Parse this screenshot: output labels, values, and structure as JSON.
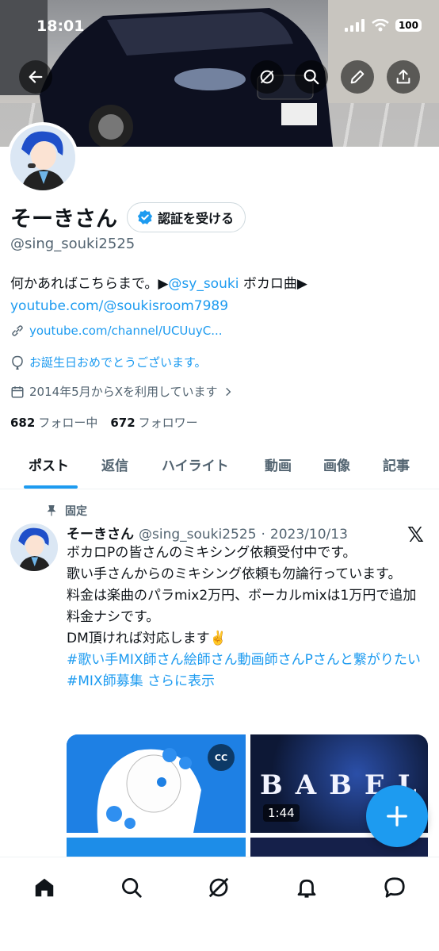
{
  "status": {
    "time": "18:01",
    "battery": "100"
  },
  "profile": {
    "display_name": "そーきさん",
    "verify_button": "認証を受ける",
    "handle": "@sing_souki2525",
    "bio_text": "何かあればこちらまで。▶",
    "bio_mention": "@sy_souki",
    "bio_text2": " ボカロ曲▶",
    "bio_link": "youtube.com/@soukisroom7989",
    "website": "youtube.com/channel/UCUuyC...",
    "birthday": "お誕生日おめでとうございます。",
    "joined": "2014年5月からXを利用しています",
    "following_count": "682",
    "following_label": "フォロー中",
    "followers_count": "672",
    "followers_label": "フォロワー"
  },
  "tabs": [
    "ポスト",
    "返信",
    "ハイライト",
    "動画",
    "画像",
    "記事"
  ],
  "post": {
    "pinned_label": "固定",
    "author_name": "そーきさん",
    "author_handle": "@sing_souki2525",
    "separator": "·",
    "date": "2023/10/13",
    "lines": [
      "ボカロPの皆さんのミキシング依頼受付中です。",
      "歌い手さんからのミキシング依頼も勿論行っています。",
      "料金は楽曲のパラmix2万円、ボーカルmixは1万円で追加料金ナシです。",
      "DM頂ければ対応します✌️"
    ],
    "hashtag1": "#歌い手MIX師さん絵師さん動画師さんPさんと繋がりたい",
    "hashtag2": "#MIX師募集",
    "show_more": "さらに表示",
    "media": {
      "cc_badge": "CC",
      "video_title": "BABEL",
      "video_duration": "1:44"
    }
  },
  "icons": {
    "back": "arrow-left-icon",
    "grok": "grok-icon",
    "search": "search-icon",
    "edit": "pencil-icon",
    "share": "share-icon",
    "verified": "verified-badge-icon",
    "link": "link-icon",
    "balloon": "balloon-icon",
    "calendar": "calendar-icon",
    "pin": "pin-icon",
    "compose": "plus-icon"
  },
  "colors": {
    "accent": "#1d9bf0",
    "text": "#0f1419",
    "secondary": "#536471"
  }
}
